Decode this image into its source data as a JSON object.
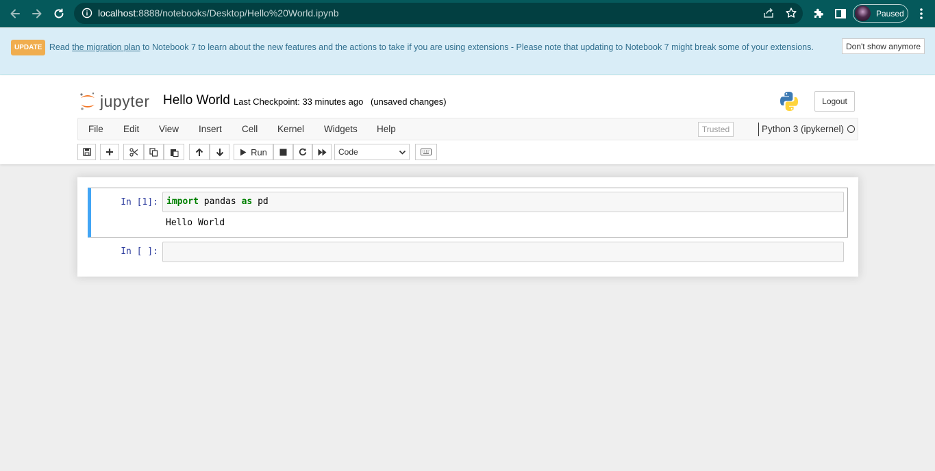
{
  "browser": {
    "url_host": "localhost",
    "url_rest": ":8888/notebooks/Desktop/Hello%20World.ipynb",
    "profile_label": "Paused"
  },
  "banner": {
    "badge": "UPDATE",
    "text_before": "Read ",
    "link": "the migration plan",
    "text_after": " to Notebook 7 to learn about the new features and the actions to take if you are using extensions - Please note that updating to Notebook 7 might break some of your extensions.",
    "dismiss_label": "Don't show anymore"
  },
  "header": {
    "logo_text": "jupyter",
    "notebook_title": "Hello World",
    "checkpoint": "Last Checkpoint: 33 minutes ago",
    "unsaved": "(unsaved changes)",
    "logout_label": "Logout"
  },
  "menu": {
    "items": [
      "File",
      "Edit",
      "View",
      "Insert",
      "Cell",
      "Kernel",
      "Widgets",
      "Help"
    ],
    "trusted_label": "Trusted",
    "kernel_name": "Python 3 (ipykernel)"
  },
  "toolbar": {
    "run_label": "Run",
    "cell_type": "Code"
  },
  "cells": [
    {
      "prompt": "In [1]:",
      "code_tokens": [
        {
          "text": "import",
          "kw": true
        },
        {
          "text": " pandas ",
          "kw": false
        },
        {
          "text": "as",
          "kw": true
        },
        {
          "text": " pd",
          "kw": false
        }
      ],
      "output": "Hello World"
    },
    {
      "prompt": "In [ ]:",
      "code_tokens": [],
      "output": ""
    }
  ],
  "colors": {
    "chrome_bg": "#05595b",
    "banner_bg": "#d9edf7",
    "selected_cell_border": "#42a5f5",
    "prompt_color": "#303f9f",
    "keyword_color": "#008000"
  }
}
